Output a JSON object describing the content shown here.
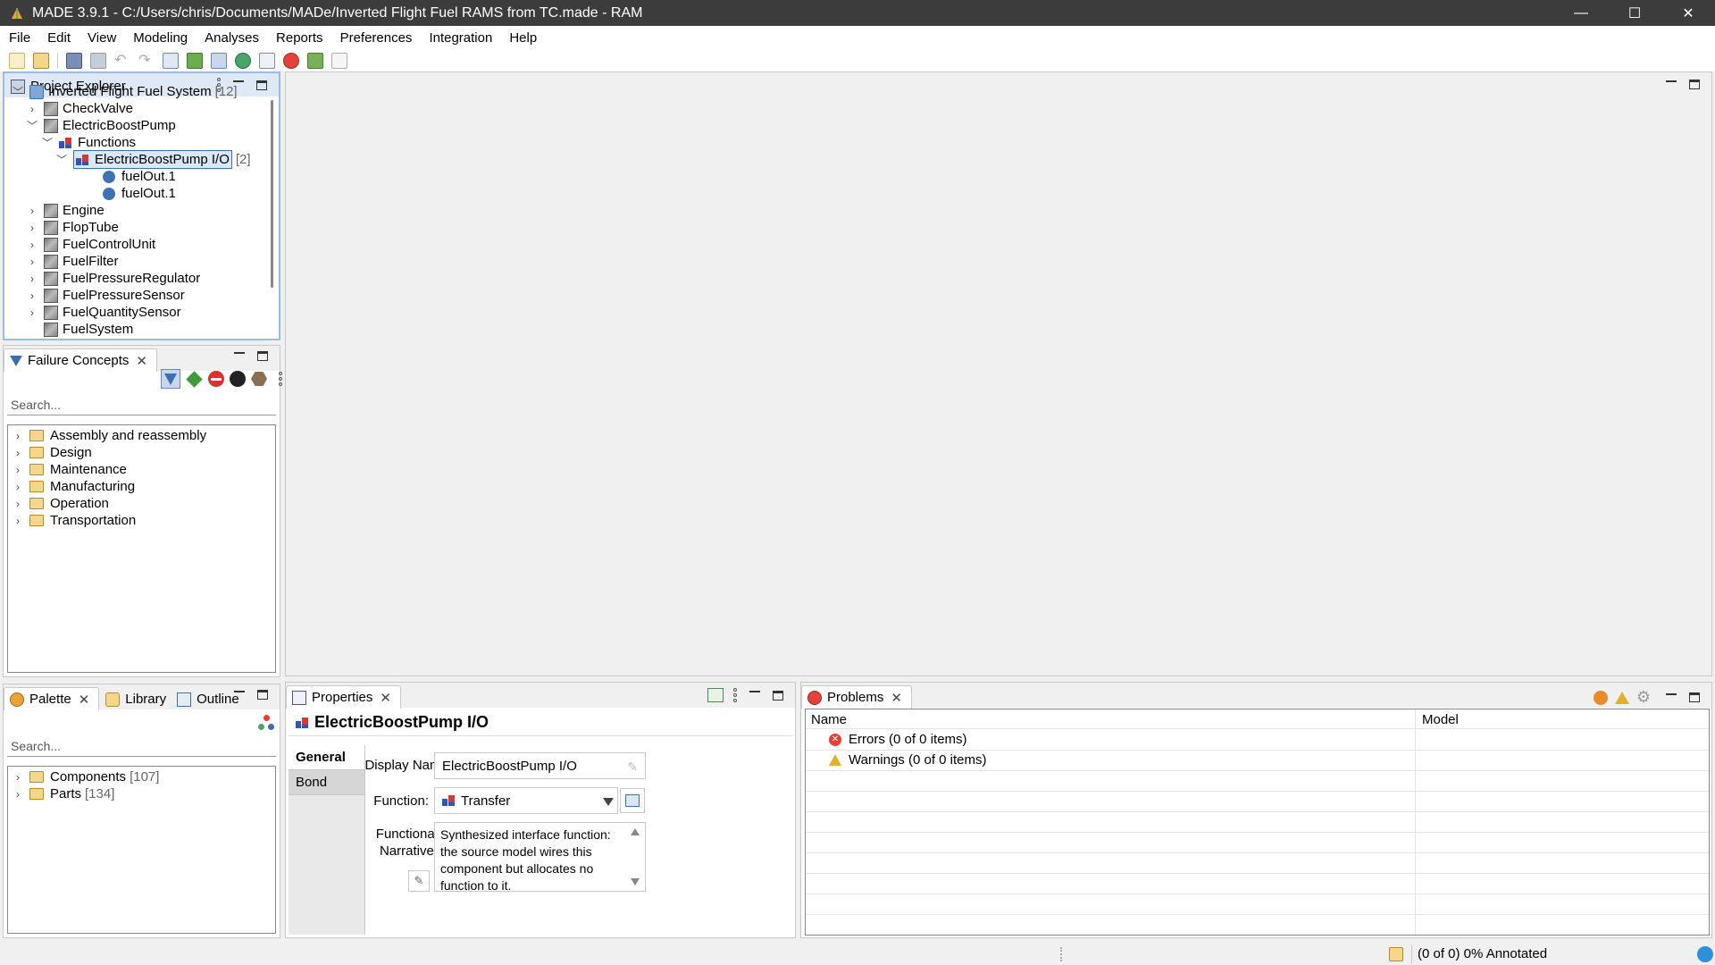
{
  "window": {
    "title": "MADE 3.9.1 - C:/Users/chris/Documents/MADe/Inverted Flight Fuel RAMS from TC.made - RAM",
    "minimize": "—",
    "maximize": "☐",
    "close": "✕"
  },
  "menu": [
    "File",
    "Edit",
    "View",
    "Modeling",
    "Analyses",
    "Reports",
    "Preferences",
    "Integration",
    "Help"
  ],
  "project_explorer": {
    "tab_label": "Project Explorer",
    "root": {
      "label": "Inverted Flight Fuel System",
      "count": "[12]"
    },
    "items": [
      {
        "label": "CheckValve"
      },
      {
        "label": "ElectricBoostPump"
      },
      {
        "label": "Functions"
      },
      {
        "label": "ElectricBoostPump I/O",
        "count": "[2]"
      },
      {
        "label": "fuelOut.1"
      },
      {
        "label": "fuelOut.1"
      },
      {
        "label": "Engine"
      },
      {
        "label": "FlopTube"
      },
      {
        "label": "FuelControlUnit"
      },
      {
        "label": "FuelFilter"
      },
      {
        "label": "FuelPressureRegulator"
      },
      {
        "label": "FuelPressureSensor"
      },
      {
        "label": "FuelQuantitySensor"
      },
      {
        "label": "FuelSystem"
      }
    ]
  },
  "failure_concepts": {
    "tab_label": "Failure Concepts",
    "search_placeholder": "Search...",
    "folders": [
      "Assembly and reassembly",
      "Design",
      "Maintenance",
      "Manufacturing",
      "Operation",
      "Transportation"
    ]
  },
  "palette": {
    "tabs": [
      "Palette",
      "Library",
      "Outline"
    ],
    "search_placeholder": "Search...",
    "folders": [
      {
        "label": "Components",
        "count": "[107]"
      },
      {
        "label": "Parts",
        "count": "[134]"
      }
    ]
  },
  "properties": {
    "tab_label": "Properties",
    "heading": "ElectricBoostPump I/O",
    "side_tabs": [
      "General",
      "Bond"
    ],
    "display_name_label": "Display Name:",
    "display_name_value": "ElectricBoostPump I/O",
    "function_label": "Function:",
    "function_value": "Transfer",
    "narrative_label_1": "Functional",
    "narrative_label_2": "Narrative:",
    "narrative_text": "Synthesized interface function: the source model wires this component but allocates no function to it."
  },
  "problems": {
    "tab_label": "Problems",
    "columns": [
      "Name",
      "Model"
    ],
    "rows": [
      "Errors (0 of 0 items)",
      "Warnings (0 of 0 items)"
    ]
  },
  "status": {
    "annotated": "(0 of 0) 0% Annotated"
  },
  "colors": {
    "titlebar": "#3c3c3c",
    "selection": "#3a6fb5",
    "active_border": "#9fbadf"
  }
}
